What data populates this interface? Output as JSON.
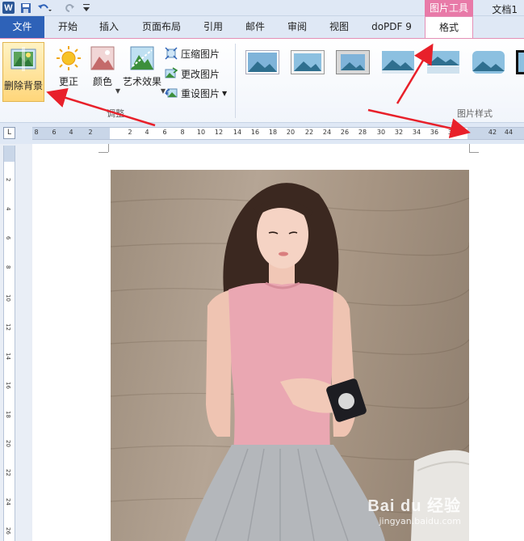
{
  "window": {
    "doc_title": "文档1",
    "app_logo": "W"
  },
  "quick_access": {
    "icons": [
      "save-icon",
      "undo-icon",
      "redo-icon",
      "customize-icon"
    ]
  },
  "context_tab": {
    "group_label": "图片工具"
  },
  "tabs": [
    {
      "label": "文件",
      "active": false
    },
    {
      "label": "开始",
      "active": false
    },
    {
      "label": "插入",
      "active": false
    },
    {
      "label": "页面布局",
      "active": false
    },
    {
      "label": "引用",
      "active": false
    },
    {
      "label": "邮件",
      "active": false
    },
    {
      "label": "审阅",
      "active": false
    },
    {
      "label": "视图",
      "active": false
    },
    {
      "label": "doPDF 9",
      "active": false
    },
    {
      "label": "格式",
      "active": true
    }
  ],
  "ribbon": {
    "adjust_group": {
      "label": "调整",
      "remove_background": "删除背景",
      "corrections": "更正",
      "color": "颜色",
      "artistic_effects": "艺术效果",
      "compress": "压缩图片",
      "change_picture": "更改图片",
      "reset_picture": "重设图片"
    },
    "styles_group": {
      "label": "图片样式"
    }
  },
  "ruler": {
    "corner": "L",
    "numbers": [
      "8",
      "6",
      "4",
      "2",
      "2",
      "4",
      "6",
      "8",
      "10",
      "12",
      "14",
      "16",
      "18",
      "20",
      "22",
      "24",
      "26",
      "28",
      "30",
      "32",
      "34",
      "36",
      "38",
      "42",
      "44"
    ],
    "v_numbers": [
      "2",
      "4",
      "6",
      "8",
      "10",
      "12",
      "14",
      "16",
      "18",
      "20",
      "22",
      "24",
      "26"
    ]
  },
  "watermark": {
    "logo": "Bai du 经验",
    "url": "jingyan.baidu.com"
  },
  "colors": {
    "accent": "#2e62b8",
    "context_pink": "#e87aa8",
    "arrow_red": "#e8202a"
  }
}
